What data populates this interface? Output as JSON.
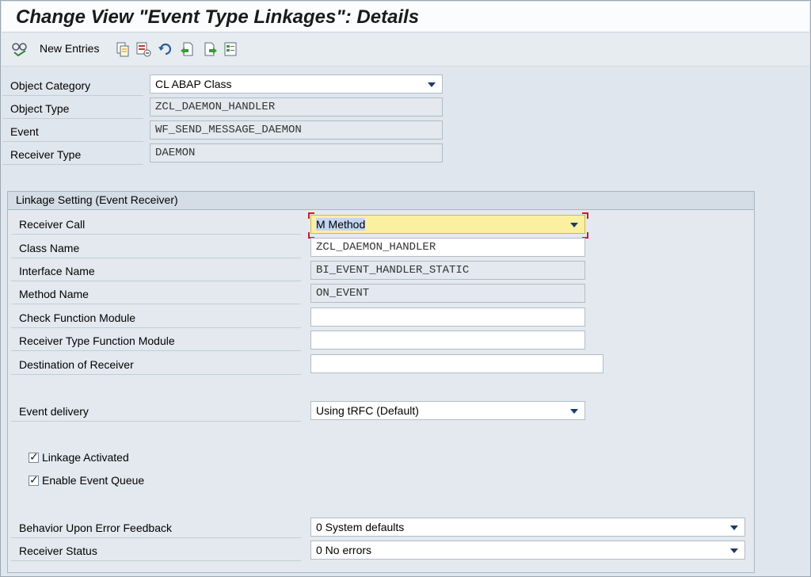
{
  "title": "Change View \"Event Type Linkages\": Details",
  "toolbar": {
    "new_entries_label": "New Entries",
    "icons": [
      "glasses-change-icon",
      "copy-icon",
      "delete-icon",
      "undo-icon",
      "previous-entry-icon",
      "next-entry-icon",
      "select-all-icon"
    ]
  },
  "header_fields": {
    "object_category": {
      "label": "Object Category",
      "value": "CL ABAP Class"
    },
    "object_type": {
      "label": "Object Type",
      "value": "ZCL_DAEMON_HANDLER"
    },
    "event": {
      "label": "Event",
      "value": "WF_SEND_MESSAGE_DAEMON"
    },
    "receiver_type": {
      "label": "Receiver Type",
      "value": "DAEMON"
    }
  },
  "linkage": {
    "group_title": "Linkage Setting (Event Receiver)",
    "receiver_call": {
      "label": "Receiver Call",
      "value": "M Method"
    },
    "class_name": {
      "label": "Class Name",
      "value": "ZCL_DAEMON_HANDLER"
    },
    "interface_name": {
      "label": "Interface Name",
      "value": "BI_EVENT_HANDLER_STATIC"
    },
    "method_name": {
      "label": "Method Name",
      "value": "ON_EVENT"
    },
    "check_fm": {
      "label": "Check Function Module",
      "value": ""
    },
    "receiver_type_fm": {
      "label": "Receiver Type Function Module",
      "value": ""
    },
    "destination": {
      "label": "Destination of Receiver",
      "value": ""
    },
    "event_delivery": {
      "label": "Event delivery",
      "value": "Using tRFC (Default)"
    },
    "linkage_activated": {
      "label": "Linkage Activated",
      "checked": true
    },
    "enable_event_queue": {
      "label": "Enable Event Queue",
      "checked": true
    },
    "behavior_error": {
      "label": "Behavior Upon Error Feedback",
      "value": "0 System defaults"
    },
    "receiver_status": {
      "label": "Receiver Status",
      "value": "0 No errors"
    }
  },
  "colors": {
    "background": "#dfe6ed",
    "focus_highlight": "#fbf0a0",
    "focus_corner": "#d01b1b",
    "dropdown_arrow": "#1d3b66"
  }
}
